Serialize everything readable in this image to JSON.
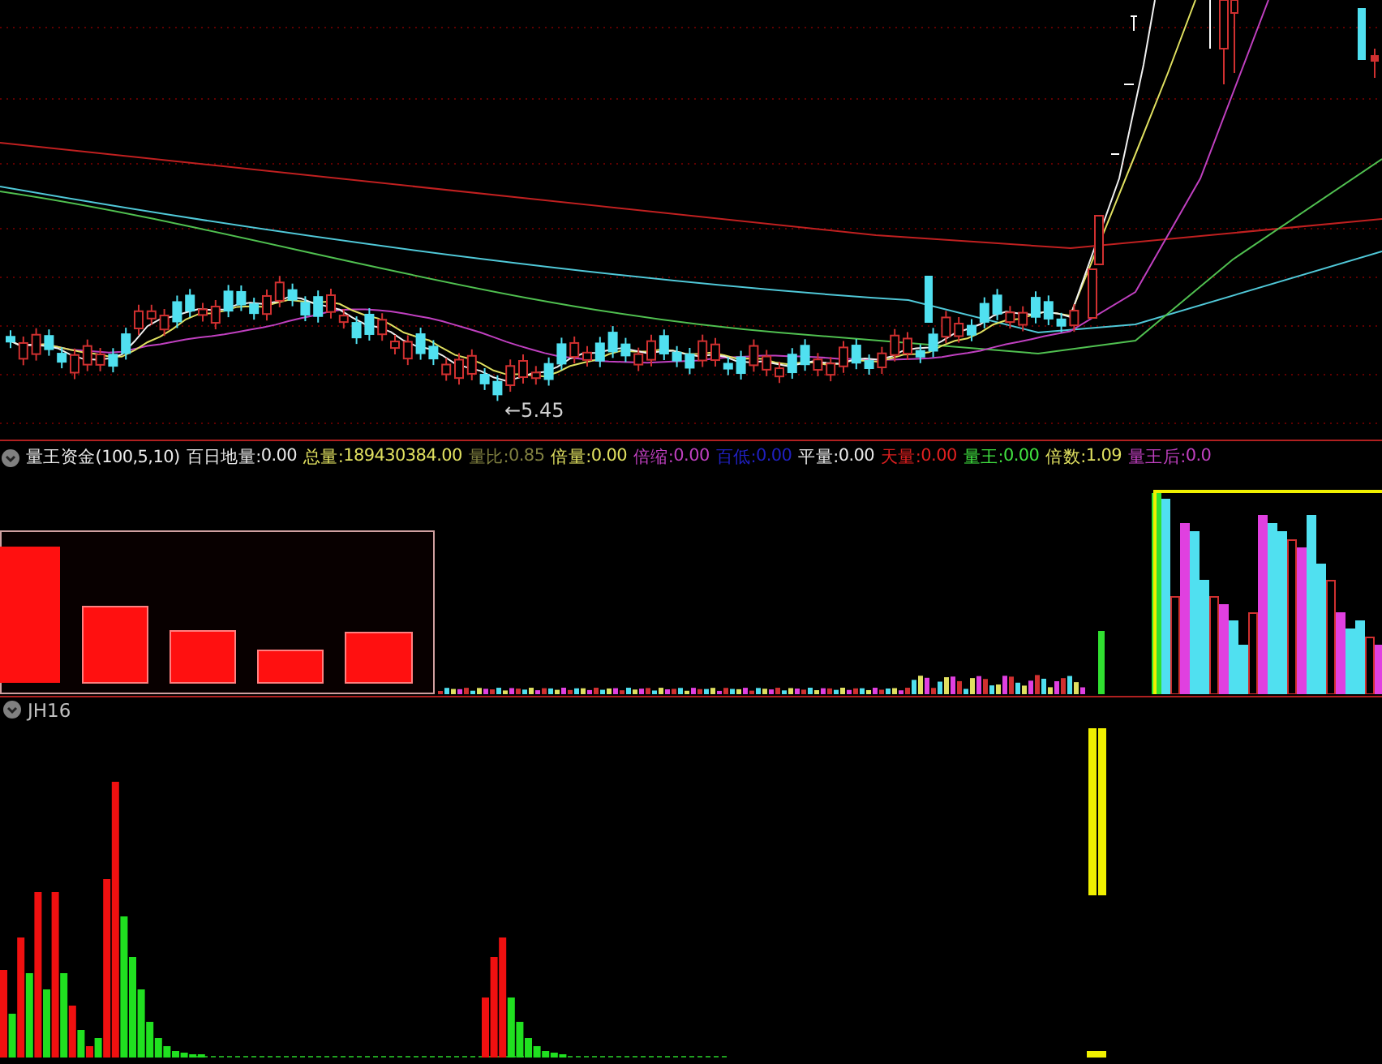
{
  "price_panel": {
    "low_marker": "←5.45"
  },
  "indicator_bar": {
    "title": "量王资金(100,5,10)",
    "fields": [
      {
        "label": "百日地量:",
        "value": "0.00",
        "color": "#e8e8e8"
      },
      {
        "label": "总量:",
        "value": "189430384.00",
        "color": "#e0e060"
      },
      {
        "label": "量比:",
        "value": "0.85",
        "color": "#808040"
      },
      {
        "label": "倍量:",
        "value": "0.00",
        "color": "#e0e060"
      },
      {
        "label": "倍缩:",
        "value": "0.00",
        "color": "#c040c0"
      },
      {
        "label": "百低:",
        "value": "0.00",
        "color": "#2020c0"
      },
      {
        "label": "平量:",
        "value": "0.00",
        "color": "#e8e8e8"
      },
      {
        "label": "天量:",
        "value": "0.00",
        "color": "#e02020"
      },
      {
        "label": "量王:",
        "value": "0.00",
        "color": "#40e040"
      },
      {
        "label": "倍数:",
        "value": "1.09",
        "color": "#e0e060"
      },
      {
        "label": "量王后:",
        "value": "0.0",
        "color": "#c040c0"
      }
    ]
  },
  "jh16_panel": {
    "title": "JH16"
  }
}
